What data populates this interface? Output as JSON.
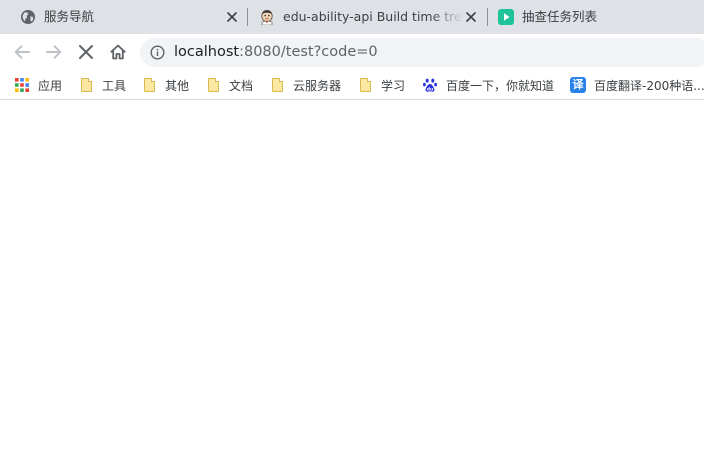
{
  "tabs": [
    {
      "title": "服务导航",
      "favicon": "globe-icon",
      "close": "×"
    },
    {
      "title": "edu-ability-api Build time trend",
      "favicon": "jenkins-icon",
      "close": "×"
    },
    {
      "title": "抽查任务列表",
      "favicon": "play-icon",
      "favicon_color": "#1fc39a"
    }
  ],
  "toolbar": {
    "back": "arrow-left-icon",
    "forward": "arrow-right-icon",
    "stop": "close-icon",
    "home": "home-icon"
  },
  "omnibox": {
    "info_icon": "info-icon",
    "url_host": "localhost",
    "url_rest": ":8080/test?code=0"
  },
  "bookmarks": [
    {
      "label": "应用",
      "icon": "apps-grid-icon"
    },
    {
      "label": "工具",
      "icon": "folder-icon"
    },
    {
      "label": "其他",
      "icon": "folder-icon"
    },
    {
      "label": "文档",
      "icon": "folder-icon"
    },
    {
      "label": "云服务器",
      "icon": "folder-icon"
    },
    {
      "label": "学习",
      "icon": "folder-icon"
    },
    {
      "label": "百度一下，你就知道",
      "icon": "baidu-paw-icon",
      "color": "#2932e1"
    },
    {
      "label": "百度翻译-200种语...",
      "icon": "translate-icon",
      "icon_text": "译",
      "color": "#2a83e8"
    }
  ],
  "colors": {
    "tab_strip": "#dee1e6",
    "omnibox_bg": "#f1f3f4",
    "folder_fill": "#fbe7a1"
  }
}
